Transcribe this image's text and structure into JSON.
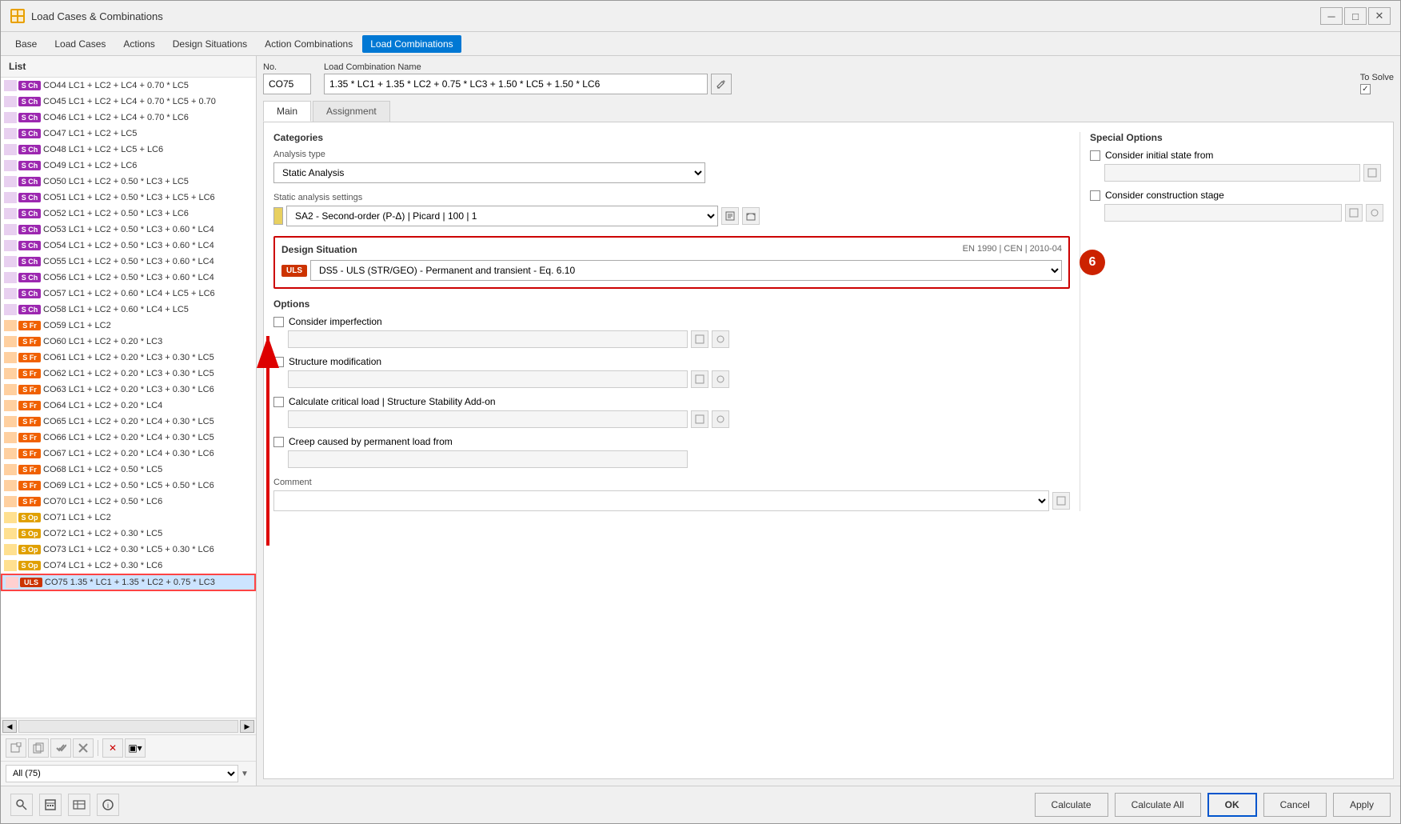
{
  "window": {
    "title": "Load Cases & Combinations",
    "icon": "LC"
  },
  "menu": {
    "items": [
      "Base",
      "Load Cases",
      "Actions",
      "Design Situations",
      "Action Combinations",
      "Load Combinations"
    ],
    "active": "Load Combinations"
  },
  "list": {
    "header": "List",
    "filter": "All (75)",
    "items": [
      {
        "no": "CO44",
        "badge": "S Ch",
        "badgeType": "sch",
        "text": "LC1 + LC2 + LC4 + 0.70 * LC5",
        "color": "#e8d0f0"
      },
      {
        "no": "CO45",
        "badge": "S Ch",
        "badgeType": "sch",
        "text": "LC1 + LC2 + LC4 + 0.70 * LC5 + 0.70",
        "color": "#e8d0f0"
      },
      {
        "no": "CO46",
        "badge": "S Ch",
        "badgeType": "sch",
        "text": "LC1 + LC2 + LC4 + 0.70 * LC6",
        "color": "#e8d0f0"
      },
      {
        "no": "CO47",
        "badge": "S Ch",
        "badgeType": "sch",
        "text": "LC1 + LC2 + LC5",
        "color": "#e8d0f0"
      },
      {
        "no": "CO48",
        "badge": "S Ch",
        "badgeType": "sch",
        "text": "LC1 + LC2 + LC5 + LC6",
        "color": "#e8d0f0"
      },
      {
        "no": "CO49",
        "badge": "S Ch",
        "badgeType": "sch",
        "text": "LC1 + LC2 + LC6",
        "color": "#e8d0f0"
      },
      {
        "no": "CO50",
        "badge": "S Ch",
        "badgeType": "sch",
        "text": "LC1 + LC2 + 0.50 * LC3 + LC5",
        "color": "#e8d0f0"
      },
      {
        "no": "CO51",
        "badge": "S Ch",
        "badgeType": "sch",
        "text": "LC1 + LC2 + 0.50 * LC3 + LC5 + LC6",
        "color": "#e8d0f0"
      },
      {
        "no": "CO52",
        "badge": "S Ch",
        "badgeType": "sch",
        "text": "LC1 + LC2 + 0.50 * LC3 + LC6",
        "color": "#e8d0f0"
      },
      {
        "no": "CO53",
        "badge": "S Ch",
        "badgeType": "sch",
        "text": "LC1 + LC2 + 0.50 * LC3 + 0.60 * LC4",
        "color": "#e8d0f0"
      },
      {
        "no": "CO54",
        "badge": "S Ch",
        "badgeType": "sch",
        "text": "LC1 + LC2 + 0.50 * LC3 + 0.60 * LC4",
        "color": "#e8d0f0"
      },
      {
        "no": "CO55",
        "badge": "S Ch",
        "badgeType": "sch",
        "text": "LC1 + LC2 + 0.50 * LC3 + 0.60 * LC4",
        "color": "#e8d0f0"
      },
      {
        "no": "CO56",
        "badge": "S Ch",
        "badgeType": "sch",
        "text": "LC1 + LC2 + 0.50 * LC3 + 0.60 * LC4",
        "color": "#e8d0f0"
      },
      {
        "no": "CO57",
        "badge": "S Ch",
        "badgeType": "sch",
        "text": "LC1 + LC2 + 0.60 * LC4 + LC5 + LC6",
        "color": "#e8d0f0"
      },
      {
        "no": "CO58",
        "badge": "S Ch",
        "badgeType": "sch",
        "text": "LC1 + LC2 + 0.60 * LC4 + LC5",
        "color": "#e8d0f0"
      },
      {
        "no": "CO59",
        "badge": "S Fr",
        "badgeType": "sfr",
        "text": "LC1 + LC2",
        "color": "#ffd0a0"
      },
      {
        "no": "CO60",
        "badge": "S Fr",
        "badgeType": "sfr",
        "text": "LC1 + LC2 + 0.20 * LC3",
        "color": "#ffd0a0"
      },
      {
        "no": "CO61",
        "badge": "S Fr",
        "badgeType": "sfr",
        "text": "LC1 + LC2 + 0.20 * LC3 + 0.30 * LC5",
        "color": "#ffd0a0"
      },
      {
        "no": "CO62",
        "badge": "S Fr",
        "badgeType": "sfr",
        "text": "LC1 + LC2 + 0.20 * LC3 + 0.30 * LC5",
        "color": "#ffd0a0"
      },
      {
        "no": "CO63",
        "badge": "S Fr",
        "badgeType": "sfr",
        "text": "LC1 + LC2 + 0.20 * LC3 + 0.30 * LC6",
        "color": "#ffd0a0"
      },
      {
        "no": "CO64",
        "badge": "S Fr",
        "badgeType": "sfr",
        "text": "LC1 + LC2 + 0.20 * LC4",
        "color": "#ffd0a0"
      },
      {
        "no": "CO65",
        "badge": "S Fr",
        "badgeType": "sfr",
        "text": "LC1 + LC2 + 0.20 * LC4 + 0.30 * LC5",
        "color": "#ffd0a0"
      },
      {
        "no": "CO66",
        "badge": "S Fr",
        "badgeType": "sfr",
        "text": "LC1 + LC2 + 0.20 * LC4 + 0.30 * LC5",
        "color": "#ffd0a0"
      },
      {
        "no": "CO67",
        "badge": "S Fr",
        "badgeType": "sfr",
        "text": "LC1 + LC2 + 0.20 * LC4 + 0.30 * LC6",
        "color": "#ffd0a0"
      },
      {
        "no": "CO68",
        "badge": "S Fr",
        "badgeType": "sfr",
        "text": "LC1 + LC2 + 0.50 * LC5",
        "color": "#ffd0a0"
      },
      {
        "no": "CO69",
        "badge": "S Fr",
        "badgeType": "sfr",
        "text": "LC1 + LC2 + 0.50 * LC5 + 0.50 * LC6",
        "color": "#ffd0a0"
      },
      {
        "no": "CO70",
        "badge": "S Fr",
        "badgeType": "sfr",
        "text": "LC1 + LC2 + 0.50 * LC6",
        "color": "#ffd0a0"
      },
      {
        "no": "CO71",
        "badge": "S Op",
        "badgeType": "sop",
        "text": "LC1 + LC2",
        "color": "#ffe090"
      },
      {
        "no": "CO72",
        "badge": "S Op",
        "badgeType": "sop",
        "text": "LC1 + LC2 + 0.30 * LC5",
        "color": "#ffe090"
      },
      {
        "no": "CO73",
        "badge": "S Op",
        "badgeType": "sop",
        "text": "LC1 + LC2 + 0.30 * LC5 + 0.30 * LC6",
        "color": "#ffe090"
      },
      {
        "no": "CO74",
        "badge": "S Op",
        "badgeType": "sop",
        "text": "LC1 + LC2 + 0.30 * LC6",
        "color": "#ffe090"
      },
      {
        "no": "CO75",
        "badge": "ULS",
        "badgeType": "uls",
        "text": "1.35 * LC1 + 1.35 * LC2 + 0.75 * LC3",
        "color": "#ffd0d0",
        "selected": true
      }
    ],
    "toolbar": {
      "add_label": "+",
      "copy_label": "⧉",
      "check_label": "✓",
      "uncheck_label": "✗",
      "delete_label": "✕",
      "select_label": "▣"
    }
  },
  "detail": {
    "no_label": "No.",
    "no_value": "CO75",
    "name_label": "Load Combination Name",
    "name_value": "1.35 * LC1 + 1.35 * LC2 + 0.75 * LC3 + 1.50 * LC5 + 1.50 * LC6",
    "to_solve_label": "To Solve",
    "to_solve_checked": true,
    "tabs": [
      "Main",
      "Assignment"
    ],
    "active_tab": "Main",
    "categories_label": "Categories",
    "analysis_type_label": "Analysis type",
    "analysis_type_value": "Static Analysis",
    "static_analysis_label": "Static analysis settings",
    "static_analysis_value": "SA2 - Second-order (P-Δ) | Picard | 100 | 1",
    "design_situation": {
      "title": "Design Situation",
      "code": "EN 1990 | CEN | 2010-04",
      "uls_badge": "ULS",
      "value": "DS5 - ULS (STR/GEO) - Permanent and transient - Eq. 6.10",
      "step_number": "6"
    },
    "options": {
      "title": "Options",
      "consider_imperfection_label": "Consider imperfection",
      "consider_imperfection_checked": false,
      "structure_modification_label": "Structure modification",
      "structure_modification_checked": false,
      "calculate_critical_label": "Calculate critical load | Structure Stability Add-on",
      "calculate_critical_checked": false,
      "creep_label": "Creep caused by permanent load from",
      "creep_checked": false
    },
    "special_options": {
      "title": "Special Options",
      "initial_state_label": "Consider initial state from",
      "initial_state_checked": false,
      "construction_stage_label": "Consider construction stage",
      "construction_stage_checked": false
    },
    "comment_label": "Comment"
  },
  "bottom_bar": {
    "calculate_label": "Calculate",
    "calculate_all_label": "Calculate All",
    "ok_label": "OK",
    "cancel_label": "Cancel",
    "apply_label": "Apply"
  }
}
